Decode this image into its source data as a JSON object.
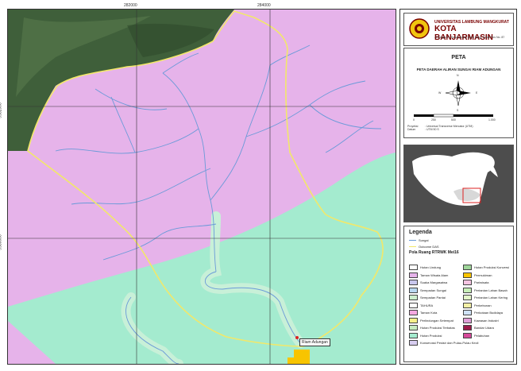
{
  "coords": {
    "top": [
      "282000",
      "284000"
    ],
    "left": [
      "9582000",
      "9580000"
    ]
  },
  "map_label": {
    "place": "Riam Adungan"
  },
  "panel": {
    "university": "UNIVERSITAS LAMBUNG MANGKURAT",
    "city": "KOTA BANJARMASIN",
    "address": "Jl. Brigjen H. Hasan Basry Kayu Tangi, Kotak Pos No. 87",
    "map_title": "PETA",
    "map_subtitle": "PETA DAERAH ALIRAN SUNGAI RIAM ADUNGAN",
    "projection_label": "Proyeksi\nDatum",
    "projection_value": ": Universal Transverse Mercator (UTM)\n: UTM 50 S",
    "compass": {
      "n": "N",
      "s": "S",
      "e": "E",
      "w": "W"
    },
    "scale_ticks": [
      "0",
      "250",
      "500",
      "1.000"
    ]
  },
  "legend": {
    "title": "Legenda",
    "line_items": [
      {
        "label": "Sungai",
        "color": "#6a9ad8"
      },
      {
        "label": "Outcome DAS",
        "color": "#f2e86a"
      }
    ],
    "section_title": "Pola Ruang RTRWK Mei16",
    "col1": [
      {
        "label": "Hutan Lindung",
        "color": "#ffffff"
      },
      {
        "label": "Taman Wisata Alam",
        "color": "#e6b3ea"
      },
      {
        "label": "Suaka Margasatwa",
        "color": "#c9c7ee"
      },
      {
        "label": "Sempadan Sungai",
        "color": "#b8d7f0"
      },
      {
        "label": "Sempadan Pantai",
        "color": "#cdeecd"
      },
      {
        "label": "TAHURA",
        "color": "#ffffff"
      },
      {
        "label": "Taman Kota",
        "color": "#f5a8e0"
      },
      {
        "label": "Perlindungan Setempat",
        "color": "#f7f08a"
      },
      {
        "label": "Hutan Produksi Terbatas",
        "color": "#c7ecc0"
      },
      {
        "label": "Hutan Produksi",
        "color": "#a4ebcf"
      },
      {
        "label": "Konservasi Pesisir dan Pulau-Pulau Kecil",
        "color": "#d8cdf0"
      }
    ],
    "col2": [
      {
        "label": "Hutan Produksi Konversi",
        "color": "#9fd69a"
      },
      {
        "label": "Permukiman",
        "color": "#f8c400"
      },
      {
        "label": "Pariwisata",
        "color": "#f6c5e3"
      },
      {
        "label": "Pertanian Lahan Basah",
        "color": "#c8f0b8"
      },
      {
        "label": "Pertanian Lahan Kering",
        "color": "#e4f7c9"
      },
      {
        "label": "Perkebunan",
        "color": "#f3f0a5"
      },
      {
        "label": "Perkotaan Budidaya",
        "color": "#cfe3f8"
      },
      {
        "label": "Kawasan Industri",
        "color": "#e0a0d8"
      },
      {
        "label": "Bandar Udara",
        "color": "#9b1b4a"
      },
      {
        "label": "Pelabuhan",
        "color": "#d64a9a"
      }
    ]
  }
}
